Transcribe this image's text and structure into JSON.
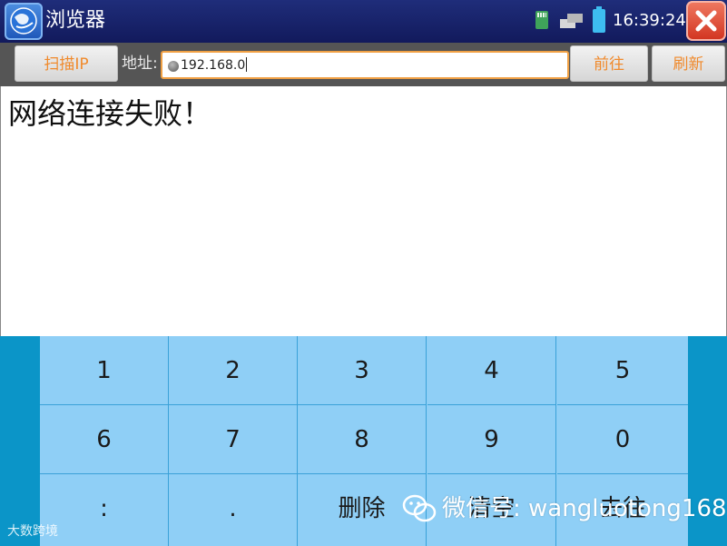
{
  "window": {
    "title": "浏览器",
    "clock": "16:39:24",
    "icons": [
      "browser-icon",
      "sd-card-icon",
      "network-icon",
      "battery-icon",
      "close-icon"
    ]
  },
  "toolbar": {
    "scan_label": "扫描IP",
    "address_label": "地址:",
    "address_value": "192.168.0",
    "go_label": "前往",
    "refresh_label": "刷新"
  },
  "content": {
    "message": "网络连接失败！"
  },
  "keypad": {
    "keys": [
      "1",
      "2",
      "3",
      "4",
      "5",
      "6",
      "7",
      "8",
      "9",
      "0",
      ":",
      ".",
      "删除",
      "清空",
      "去往"
    ]
  },
  "watermarks": {
    "left": "大数跨境",
    "right": "微信号: wangluotong168"
  },
  "colors": {
    "title_bar": "#1a2470",
    "toolbar": "#555555",
    "button_text": "#f08a2c",
    "address_border": "#f0a044",
    "keypad_bg": "#8fcff6",
    "keypad_side": "#0b95c8",
    "close_button": "#e04a35"
  }
}
